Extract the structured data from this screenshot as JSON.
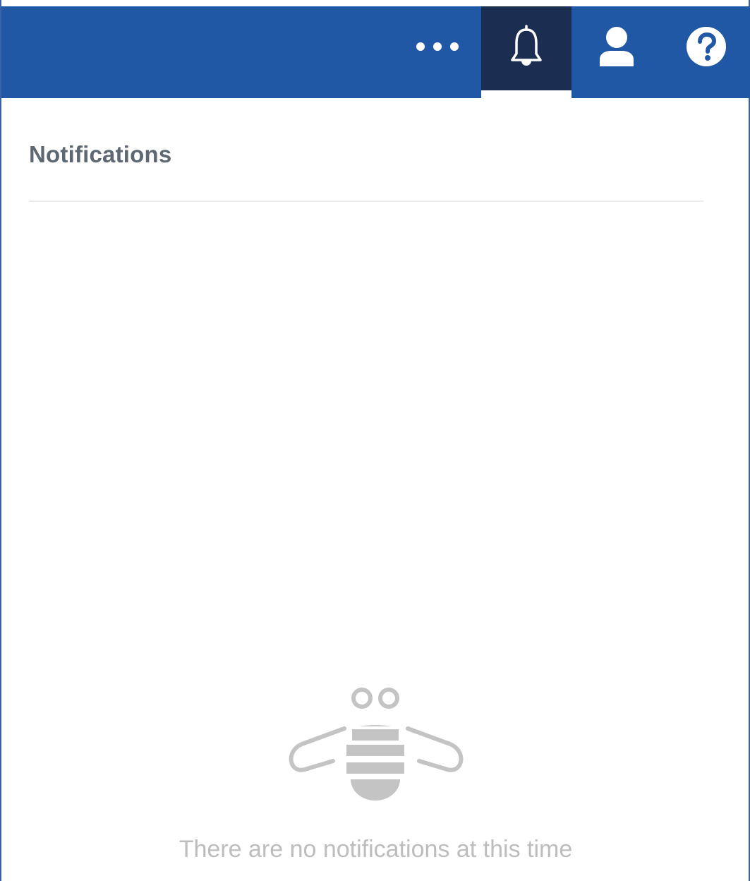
{
  "header": {
    "buttons": [
      {
        "name": "more",
        "icon": "more-horizontal-icon"
      },
      {
        "name": "notifications",
        "icon": "bell-icon",
        "active": true
      },
      {
        "name": "user",
        "icon": "user-icon"
      },
      {
        "name": "help",
        "icon": "help-icon"
      }
    ],
    "colors": {
      "bar": "#2158a6",
      "active_button": "#1b2d50",
      "icon": "#ffffff"
    }
  },
  "panel": {
    "title": "Notifications",
    "empty_state": {
      "illustration": "bee-icon",
      "message": "There are no notifications at this time"
    }
  }
}
